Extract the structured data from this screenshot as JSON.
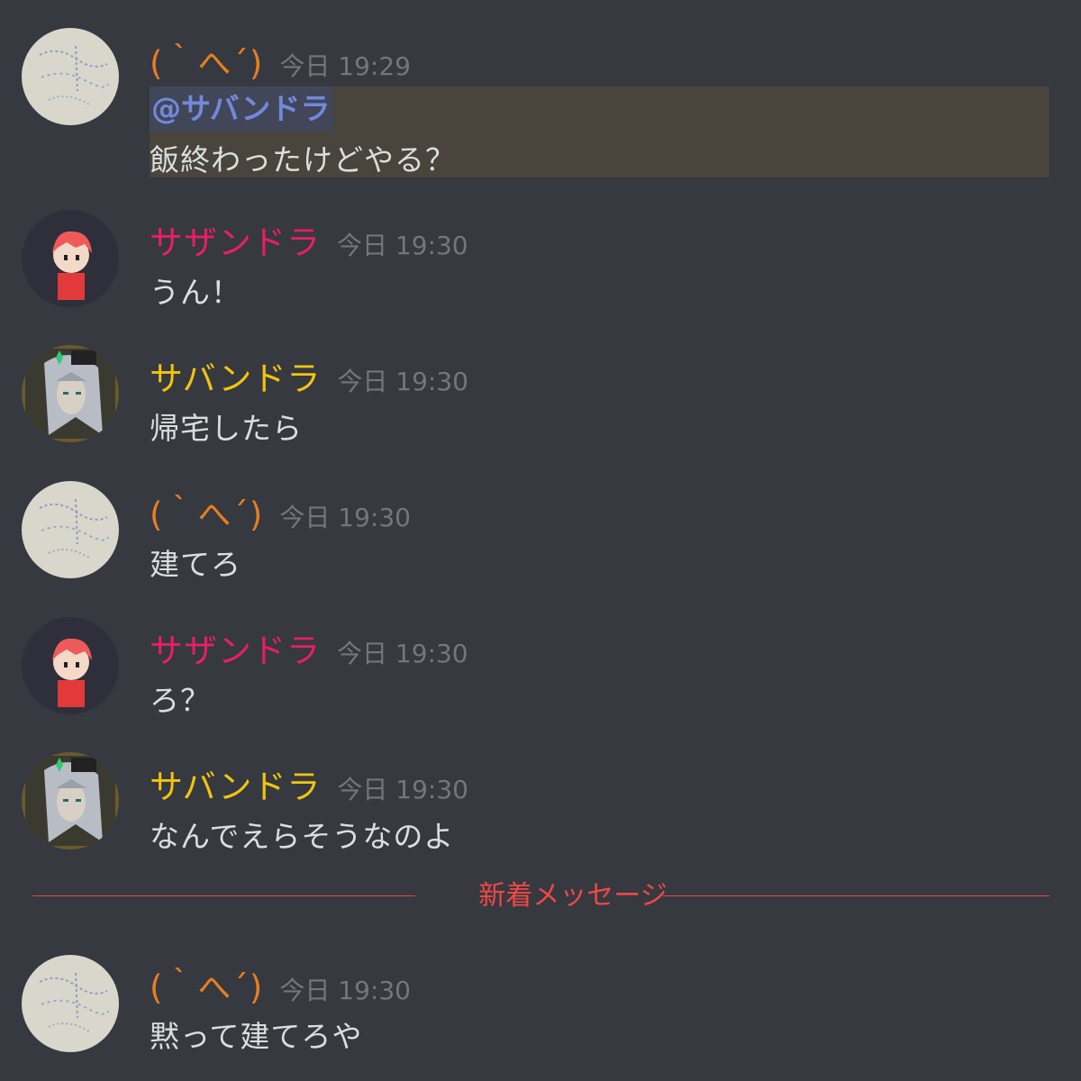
{
  "colors": {
    "background": "#36393f",
    "timestamp": "#72767d",
    "message_text": "#dcddde",
    "mention_fg": "#7289da",
    "mention_bg": "#414659",
    "highlight_bg": "#49443c",
    "new_divider": "#f04747"
  },
  "users": {
    "kaomoji": {
      "name": "(｀へ´)",
      "color": "#e67e22",
      "avatar_icon": "sketch-avatar-icon"
    },
    "sazandora": {
      "name": "サザンドラ",
      "color": "#e91e63",
      "avatar_icon": "red-hair-character-avatar-icon"
    },
    "sabandora": {
      "name": "サバンドラ",
      "color": "#f1c40f",
      "avatar_icon": "silver-hair-character-avatar-icon"
    }
  },
  "messages": [
    {
      "user": "(｀へ´)",
      "time": "今日 19:29",
      "mention": "@サバンドラ",
      "text": "飯終わったけどやる？"
    },
    {
      "user": "サザンドラ",
      "time": "今日 19:30",
      "text": "うん！"
    },
    {
      "user": "サバンドラ",
      "time": "今日 19:30",
      "text": "帰宅したら"
    },
    {
      "user": "(｀へ´)",
      "time": "今日 19:30",
      "text": "建てろ"
    },
    {
      "user": "サザンドラ",
      "time": "今日 19:30",
      "text": "ろ？"
    },
    {
      "user": "サバンドラ",
      "time": "今日 19:30",
      "text": "なんでえらそうなのよ"
    },
    {
      "user": "(｀へ´)",
      "time": "今日 19:30",
      "text": "黙って建てろや"
    }
  ],
  "new_messages_divider": {
    "label": "新着メッセージ"
  }
}
